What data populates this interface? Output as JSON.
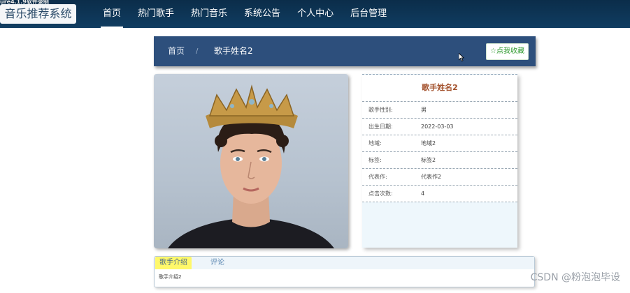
{
  "screen_recorder_label": "ure4.1.9软件录制",
  "app": {
    "title": "音乐推荐系统"
  },
  "nav": {
    "items": [
      {
        "label": "首页",
        "active": true
      },
      {
        "label": "热门歌手",
        "active": false
      },
      {
        "label": "热门音乐",
        "active": false
      },
      {
        "label": "系统公告",
        "active": false
      },
      {
        "label": "个人中心",
        "active": false
      },
      {
        "label": "后台管理",
        "active": false
      }
    ]
  },
  "breadcrumb": {
    "home": "首页",
    "separator": "/",
    "current": "歌手姓名2"
  },
  "favorite_button": {
    "icon": "star-icon",
    "label": "点我收藏"
  },
  "singer": {
    "name": "歌手姓名2",
    "fields": [
      {
        "label": "歌手性别:",
        "value": "男"
      },
      {
        "label": "出生日期:",
        "value": "2022-03-03"
      },
      {
        "label": "地域:",
        "value": "地域2"
      },
      {
        "label": "标签:",
        "value": "标签2"
      },
      {
        "label": "代表作:",
        "value": "代表作2"
      },
      {
        "label": "点击次数:",
        "value": "4"
      }
    ]
  },
  "tabs": {
    "items": [
      {
        "label": "歌手介绍",
        "active": true
      },
      {
        "label": "评论",
        "active": false
      }
    ],
    "content": "歌手介绍2"
  },
  "watermark": "CSDN @粉泡泡毕设",
  "colors": {
    "topbar": "#0b2d4a",
    "header": "#2d4f7c",
    "singer_name": "#a3522d",
    "favorite": "#2f9a2f",
    "active_tab": "#fff86a"
  }
}
